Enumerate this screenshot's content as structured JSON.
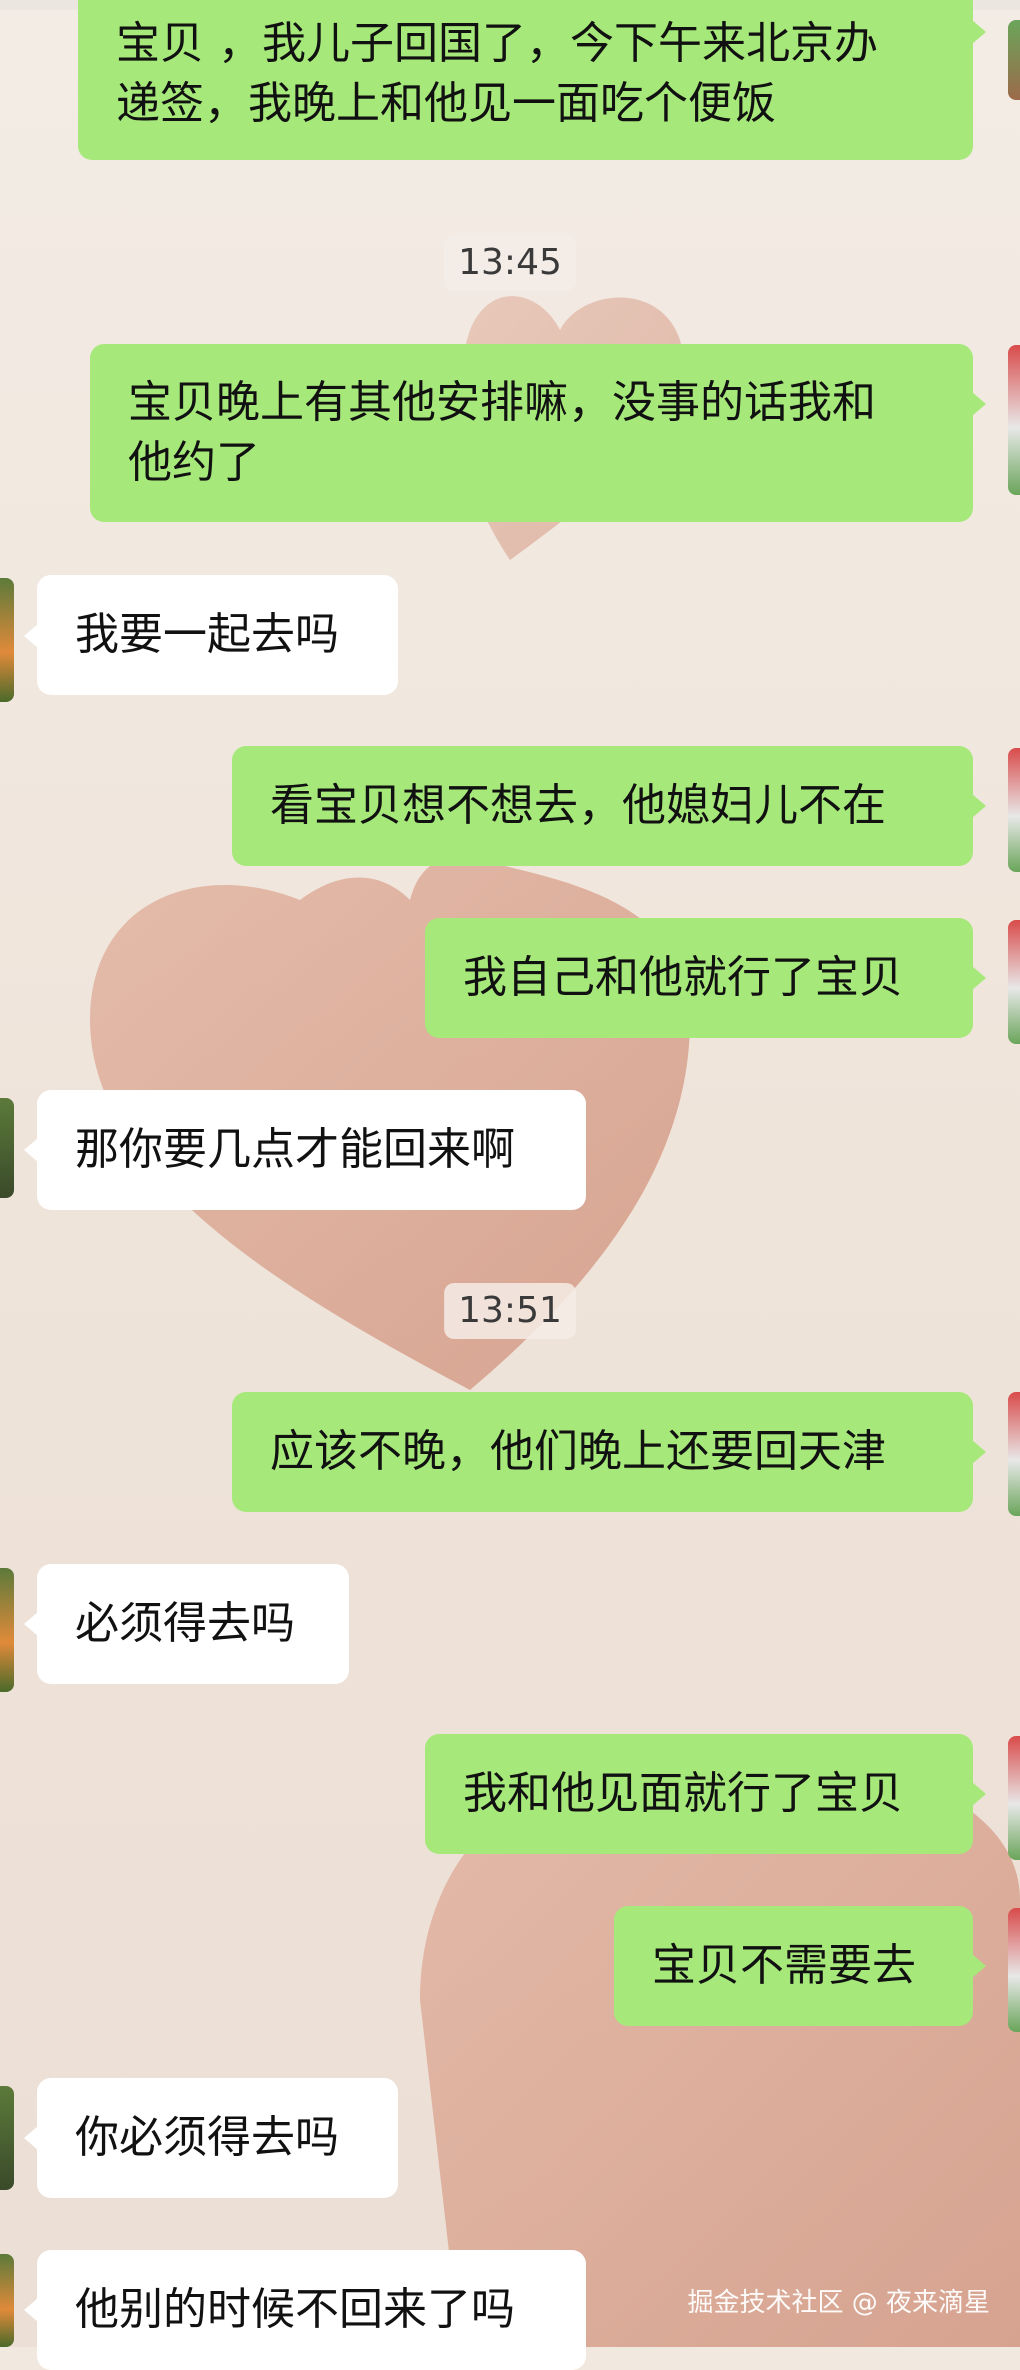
{
  "messages": [
    {
      "type": "out",
      "text": "宝贝 ，我儿子回国了，今下午来北京办\n递签，我晚上和他见一面吃个便饭"
    },
    {
      "type": "time",
      "text": "13:45"
    },
    {
      "type": "out",
      "text": "宝贝晚上有其他安排嘛，没事的话我和\n他约了"
    },
    {
      "type": "in",
      "text": "我要一起去吗"
    },
    {
      "type": "out",
      "text": "看宝贝想不想去，他媳妇儿不在"
    },
    {
      "type": "out",
      "text": "我自己和他就行了宝贝"
    },
    {
      "type": "in",
      "text": "那你要几点才能回来啊"
    },
    {
      "type": "time",
      "text": "13:51"
    },
    {
      "type": "out",
      "text": "应该不晚，他们晚上还要回天津"
    },
    {
      "type": "in",
      "text": "必须得去吗"
    },
    {
      "type": "out",
      "text": "我和他见面就行了宝贝"
    },
    {
      "type": "out",
      "text": "宝贝不需要去"
    },
    {
      "type": "in",
      "text": "你必须得去吗"
    },
    {
      "type": "in",
      "text": "他别的时候不回来了吗"
    }
  ],
  "watermark": "掘金技术社区 @ 夜来滴星",
  "colors": {
    "outgoing": "#a6e97a",
    "incoming": "#ffffff",
    "background": "#f1e8e0",
    "heart": "#d9a08c"
  }
}
